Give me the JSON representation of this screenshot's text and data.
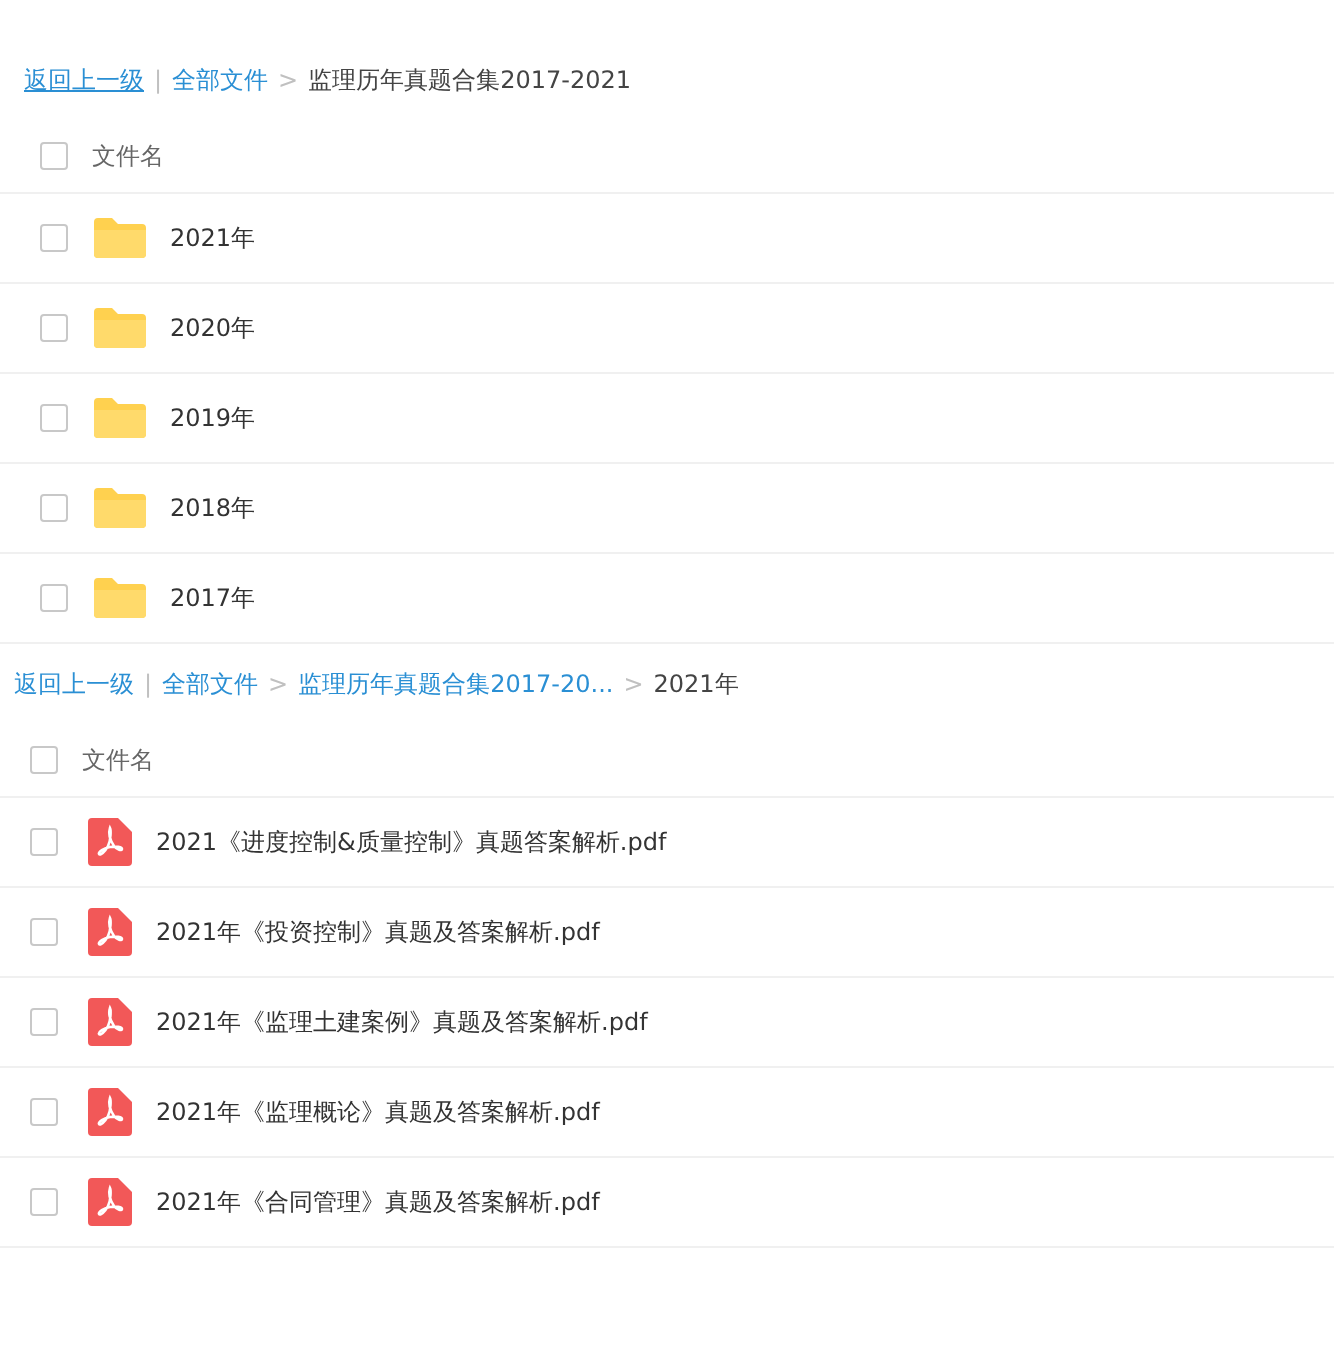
{
  "panels": [
    {
      "breadcrumb": [
        {
          "text": "返回上一级",
          "kind": "back"
        },
        {
          "text": "|",
          "kind": "sep"
        },
        {
          "text": "全部文件",
          "kind": "link"
        },
        {
          "text": ">",
          "kind": "sep"
        },
        {
          "text": "监理历年真题合集2017-2021",
          "kind": "current"
        }
      ],
      "header": {
        "label": "文件名",
        "checked": false
      },
      "rows": [
        {
          "name": "2021年",
          "kind": "folder",
          "checked": false
        },
        {
          "name": "2020年",
          "kind": "folder",
          "checked": false
        },
        {
          "name": "2019年",
          "kind": "folder",
          "checked": false
        },
        {
          "name": "2018年",
          "kind": "folder",
          "checked": false
        },
        {
          "name": "2017年",
          "kind": "folder",
          "checked": false
        }
      ]
    },
    {
      "breadcrumb": [
        {
          "text": "返回上一级",
          "kind": "link"
        },
        {
          "text": "|",
          "kind": "sep"
        },
        {
          "text": "全部文件",
          "kind": "link"
        },
        {
          "text": ">",
          "kind": "sep"
        },
        {
          "text": "监理历年真题合集2017-20...",
          "kind": "link"
        },
        {
          "text": ">",
          "kind": "sep"
        },
        {
          "text": "2021年",
          "kind": "current"
        }
      ],
      "header": {
        "label": "文件名",
        "checked": false
      },
      "rows": [
        {
          "name": "2021《进度控制&质量控制》真题答案解析.pdf",
          "kind": "pdf",
          "checked": false
        },
        {
          "name": "2021年《投资控制》真题及答案解析.pdf",
          "kind": "pdf",
          "checked": false
        },
        {
          "name": "2021年《监理土建案例》真题及答案解析.pdf",
          "kind": "pdf",
          "checked": false
        },
        {
          "name": "2021年《监理概论》真题及答案解析.pdf",
          "kind": "pdf",
          "checked": false
        },
        {
          "name": "2021年《合同管理》真题及答案解析.pdf",
          "kind": "pdf",
          "checked": false
        }
      ]
    }
  ]
}
